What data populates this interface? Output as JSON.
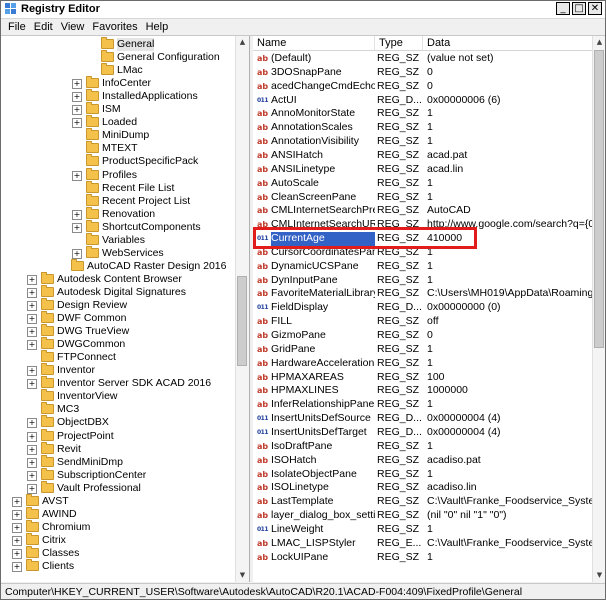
{
  "window": {
    "title": "Registry Editor",
    "buttons": [
      "_",
      "□",
      "✕"
    ]
  },
  "menu": [
    "File",
    "Edit",
    "View",
    "Favorites",
    "Help"
  ],
  "tree": [
    {
      "label": "General",
      "indent": 6,
      "exp": "",
      "selected": true
    },
    {
      "label": "General Configuration",
      "indent": 6,
      "exp": ""
    },
    {
      "label": "LMac",
      "indent": 6,
      "exp": ""
    },
    {
      "label": "InfoCenter",
      "indent": 5,
      "exp": "+"
    },
    {
      "label": "InstalledApplications",
      "indent": 5,
      "exp": "+"
    },
    {
      "label": "ISM",
      "indent": 5,
      "exp": "+"
    },
    {
      "label": "Loaded",
      "indent": 5,
      "exp": "+"
    },
    {
      "label": "MiniDump",
      "indent": 5,
      "exp": ""
    },
    {
      "label": "MTEXT",
      "indent": 5,
      "exp": ""
    },
    {
      "label": "ProductSpecificPack",
      "indent": 5,
      "exp": ""
    },
    {
      "label": "Profiles",
      "indent": 5,
      "exp": "+"
    },
    {
      "label": "Recent File List",
      "indent": 5,
      "exp": ""
    },
    {
      "label": "Recent Project List",
      "indent": 5,
      "exp": ""
    },
    {
      "label": "Renovation",
      "indent": 5,
      "exp": "+"
    },
    {
      "label": "ShortcutComponents",
      "indent": 5,
      "exp": "+"
    },
    {
      "label": "Variables",
      "indent": 5,
      "exp": ""
    },
    {
      "label": "WebServices",
      "indent": 5,
      "exp": "+"
    },
    {
      "label": "AutoCAD Raster Design 2016",
      "indent": 4,
      "exp": ""
    },
    {
      "label": "Autodesk Content Browser",
      "indent": 2,
      "exp": "+"
    },
    {
      "label": "Autodesk Digital Signatures",
      "indent": 2,
      "exp": "+"
    },
    {
      "label": "Design Review",
      "indent": 2,
      "exp": "+"
    },
    {
      "label": "DWF Common",
      "indent": 2,
      "exp": "+"
    },
    {
      "label": "DWG TrueView",
      "indent": 2,
      "exp": "+"
    },
    {
      "label": "DWGCommon",
      "indent": 2,
      "exp": "+"
    },
    {
      "label": "FTPConnect",
      "indent": 2,
      "exp": ""
    },
    {
      "label": "Inventor",
      "indent": 2,
      "exp": "+"
    },
    {
      "label": "Inventor Server SDK ACAD 2016",
      "indent": 2,
      "exp": "+"
    },
    {
      "label": "InventorView",
      "indent": 2,
      "exp": ""
    },
    {
      "label": "MC3",
      "indent": 2,
      "exp": ""
    },
    {
      "label": "ObjectDBX",
      "indent": 2,
      "exp": "+"
    },
    {
      "label": "ProjectPoint",
      "indent": 2,
      "exp": "+"
    },
    {
      "label": "Revit",
      "indent": 2,
      "exp": "+"
    },
    {
      "label": "SendMiniDmp",
      "indent": 2,
      "exp": "+"
    },
    {
      "label": "SubscriptionCenter",
      "indent": 2,
      "exp": "+"
    },
    {
      "label": "Vault Professional",
      "indent": 2,
      "exp": "+"
    },
    {
      "label": "AVST",
      "indent": 1,
      "exp": "+"
    },
    {
      "label": "AWIND",
      "indent": 1,
      "exp": "+"
    },
    {
      "label": "Chromium",
      "indent": 1,
      "exp": "+"
    },
    {
      "label": "Citrix",
      "indent": 1,
      "exp": "+"
    },
    {
      "label": "Classes",
      "indent": 1,
      "exp": "+"
    },
    {
      "label": "Clients",
      "indent": 1,
      "exp": "+"
    }
  ],
  "columns": {
    "name": "Name",
    "type": "Type",
    "data": "Data"
  },
  "values": [
    {
      "icon": "ab",
      "name": "(Default)",
      "type": "REG_SZ",
      "data": "(value not set)"
    },
    {
      "icon": "ab",
      "name": "3DOSnapPane",
      "type": "REG_SZ",
      "data": "0"
    },
    {
      "icon": "ab",
      "name": "acedChangeCmdEcho...",
      "type": "REG_SZ",
      "data": "0"
    },
    {
      "icon": "bin",
      "name": "ActUI",
      "type": "REG_D...",
      "data": "0x00000006 (6)"
    },
    {
      "icon": "ab",
      "name": "AnnoMonitorState",
      "type": "REG_SZ",
      "data": "1"
    },
    {
      "icon": "ab",
      "name": "AnnotationScales",
      "type": "REG_SZ",
      "data": "1"
    },
    {
      "icon": "ab",
      "name": "AnnotationVisibility",
      "type": "REG_SZ",
      "data": "1"
    },
    {
      "icon": "ab",
      "name": "ANSIHatch",
      "type": "REG_SZ",
      "data": "acad.pat"
    },
    {
      "icon": "ab",
      "name": "ANSILinetype",
      "type": "REG_SZ",
      "data": "acad.lin"
    },
    {
      "icon": "ab",
      "name": "AutoScale",
      "type": "REG_SZ",
      "data": "1"
    },
    {
      "icon": "ab",
      "name": "CleanScreenPane",
      "type": "REG_SZ",
      "data": "1"
    },
    {
      "icon": "ab",
      "name": "CMLInternetSearchPrefix",
      "type": "REG_SZ",
      "data": "AutoCAD"
    },
    {
      "icon": "ab",
      "name": "CMLInternetSearchURL",
      "type": "REG_SZ",
      "data": "http://www.google.com/search?q={0}"
    },
    {
      "icon": "bin",
      "name": "CurrentAge",
      "type": "REG_SZ",
      "data": "410000",
      "selected": true
    },
    {
      "icon": "ab",
      "name": "CursorCoordinatesPane",
      "type": "REG_SZ",
      "data": "1"
    },
    {
      "icon": "ab",
      "name": "DynamicUCSPane",
      "type": "REG_SZ",
      "data": "1"
    },
    {
      "icon": "ab",
      "name": "DynInputPane",
      "type": "REG_SZ",
      "data": "1"
    },
    {
      "icon": "ab",
      "name": "FavoriteMaterialLibrary",
      "type": "REG_SZ",
      "data": "C:\\Users\\MH019\\AppData\\Roaming\\Autodesk"
    },
    {
      "icon": "bin",
      "name": "FieldDisplay",
      "type": "REG_D...",
      "data": "0x00000000 (0)"
    },
    {
      "icon": "ab",
      "name": "FILL",
      "type": "REG_SZ",
      "data": "off"
    },
    {
      "icon": "ab",
      "name": "GizmoPane",
      "type": "REG_SZ",
      "data": "0"
    },
    {
      "icon": "ab",
      "name": "GridPane",
      "type": "REG_SZ",
      "data": "1"
    },
    {
      "icon": "ab",
      "name": "HardwareAcceleration...",
      "type": "REG_SZ",
      "data": "1"
    },
    {
      "icon": "ab",
      "name": "HPMAXAREAS",
      "type": "REG_SZ",
      "data": "100"
    },
    {
      "icon": "ab",
      "name": "HPMAXLINES",
      "type": "REG_SZ",
      "data": "1000000"
    },
    {
      "icon": "ab",
      "name": "InferRelationshipPane",
      "type": "REG_SZ",
      "data": "1"
    },
    {
      "icon": "bin",
      "name": "InsertUnitsDefSource",
      "type": "REG_D...",
      "data": "0x00000004 (4)"
    },
    {
      "icon": "bin",
      "name": "InsertUnitsDefTarget",
      "type": "REG_D...",
      "data": "0x00000004 (4)"
    },
    {
      "icon": "ab",
      "name": "IsoDraftPane",
      "type": "REG_SZ",
      "data": "1"
    },
    {
      "icon": "ab",
      "name": "ISOHatch",
      "type": "REG_SZ",
      "data": "acadiso.pat"
    },
    {
      "icon": "ab",
      "name": "IsolateObjectPane",
      "type": "REG_SZ",
      "data": "1"
    },
    {
      "icon": "ab",
      "name": "ISOLinetype",
      "type": "REG_SZ",
      "data": "acadiso.lin"
    },
    {
      "icon": "ab",
      "name": "LastTemplate",
      "type": "REG_SZ",
      "data": "C:\\Vault\\Franke_Foodservice_Systems\\CAD"
    },
    {
      "icon": "ab",
      "name": "layer_dialog_box_setti...",
      "type": "REG_SZ",
      "data": "(nil \"0\" nil \"1\" \"0\")"
    },
    {
      "icon": "bin",
      "name": "LineWeight",
      "type": "REG_SZ",
      "data": "1"
    },
    {
      "icon": "ab",
      "name": "LMAC_LISPStyler",
      "type": "REG_E...",
      "data": "C:\\Vault\\Franke_Foodservice_Systems\\CAD"
    },
    {
      "icon": "ab",
      "name": "LockUIPane",
      "type": "REG_SZ",
      "data": "1"
    }
  ],
  "status": "Computer\\HKEY_CURRENT_USER\\Software\\Autodesk\\AutoCAD\\R20.1\\ACAD-F004:409\\FixedProfile\\General"
}
